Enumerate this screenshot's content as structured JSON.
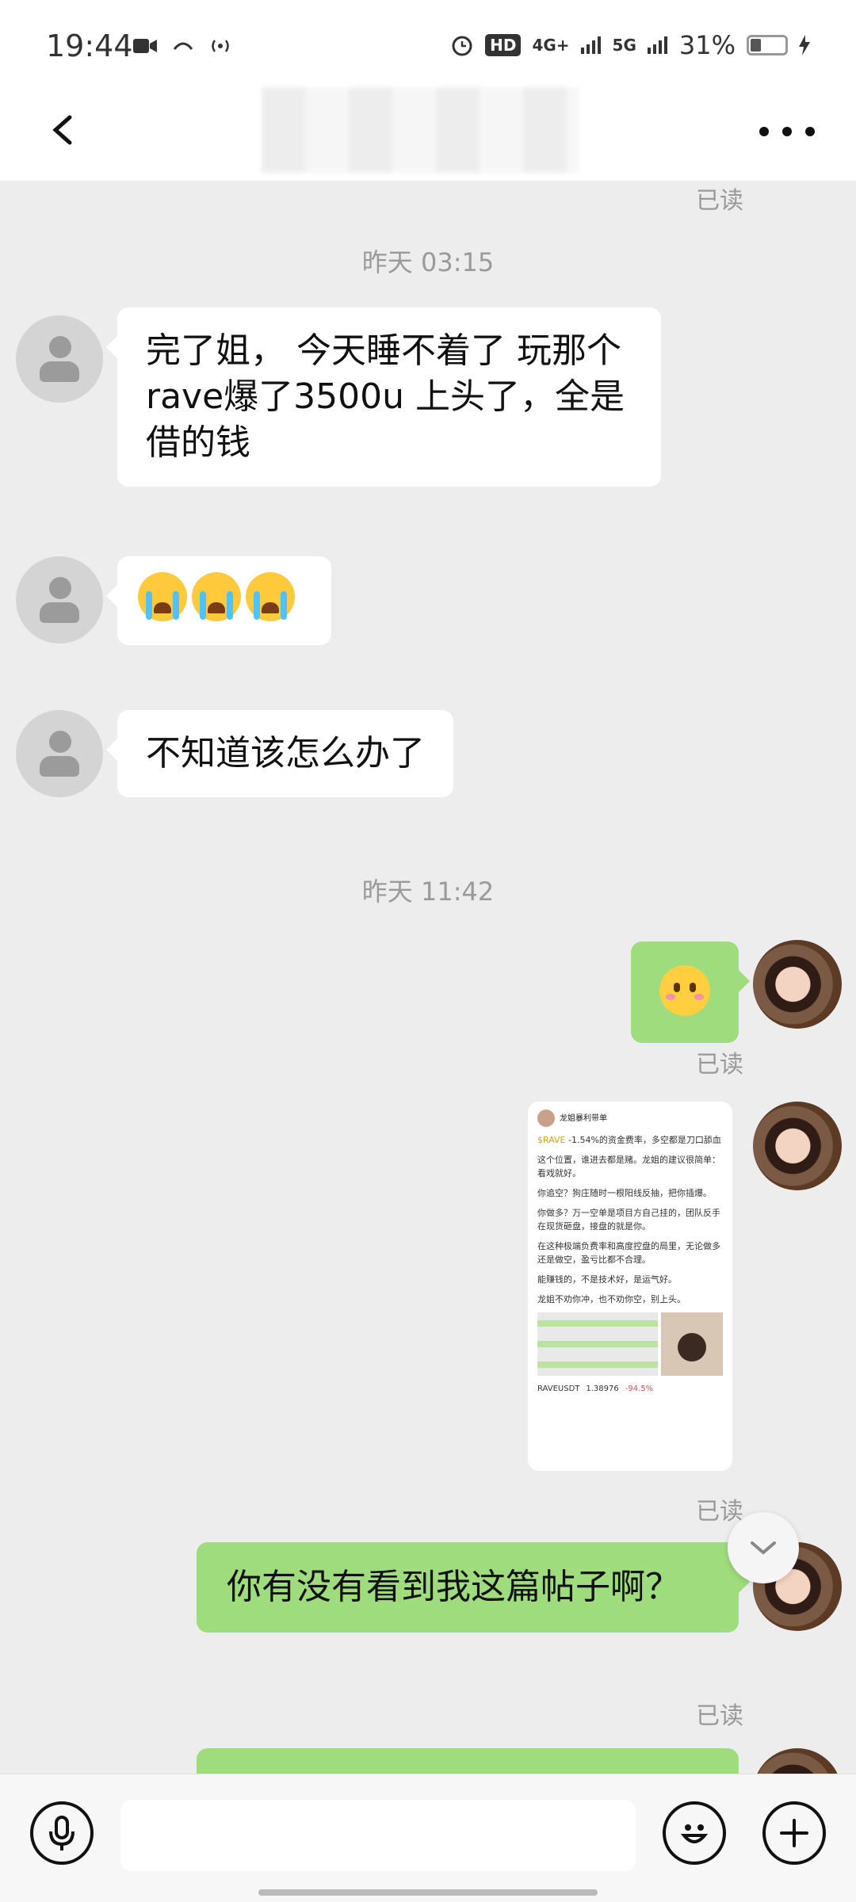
{
  "status_bar": {
    "time": "19:44",
    "hd": "HD",
    "net1": "4G+",
    "net2": "5G",
    "battery_text": "31%",
    "battery_level": 0.31
  },
  "header": {
    "back_icon": "chevron-left-icon",
    "more_icon": "more-dots-icon"
  },
  "chat": {
    "read_label": "已读",
    "timestamp_1": "昨天 03:15",
    "timestamp_2": "昨天 11:42",
    "msg_in_1": "完了姐， 今天睡不着了 玩那个rave爆了3500u 上头了，全是借的钱",
    "msg_in_3": "不知道该怎么办了",
    "msg_out_3": "你有没有看到我这篇帖子啊？",
    "shared_post": {
      "author": "龙姐暴利带单",
      "tag": "$RAVE",
      "line1": " -1.54%的资金费率，多空都是刀口舔血",
      "p2": "这个位置，谁进去都是赌。龙姐的建议很简单：看戏就好。",
      "p3": "你追空？狗庄随时一根阳线反抽，把你插爆。",
      "p4": "你做多？万一空单是项目方自己挂的，团队反手在现货砸盘，接盘的就是你。",
      "p5": "在这种极端负费率和高度控盘的局里，无论做多还是做空，盈亏比都不合理。",
      "p6": "能赚钱的，不是技术好，是运气好。",
      "p7": "龙姐不劝你冲，也不劝你空，别上头。",
      "ticker": "RAVEUSDT",
      "price": "1.38976",
      "change": "-94.5%"
    }
  },
  "input": {
    "voice_icon": "microphone-icon",
    "emoji_icon": "emoji-icon",
    "plus_icon": "plus-icon"
  },
  "colors": {
    "bubble_out": "#9fdc7d",
    "bubble_in": "#ffffff",
    "bg": "#ededed"
  }
}
